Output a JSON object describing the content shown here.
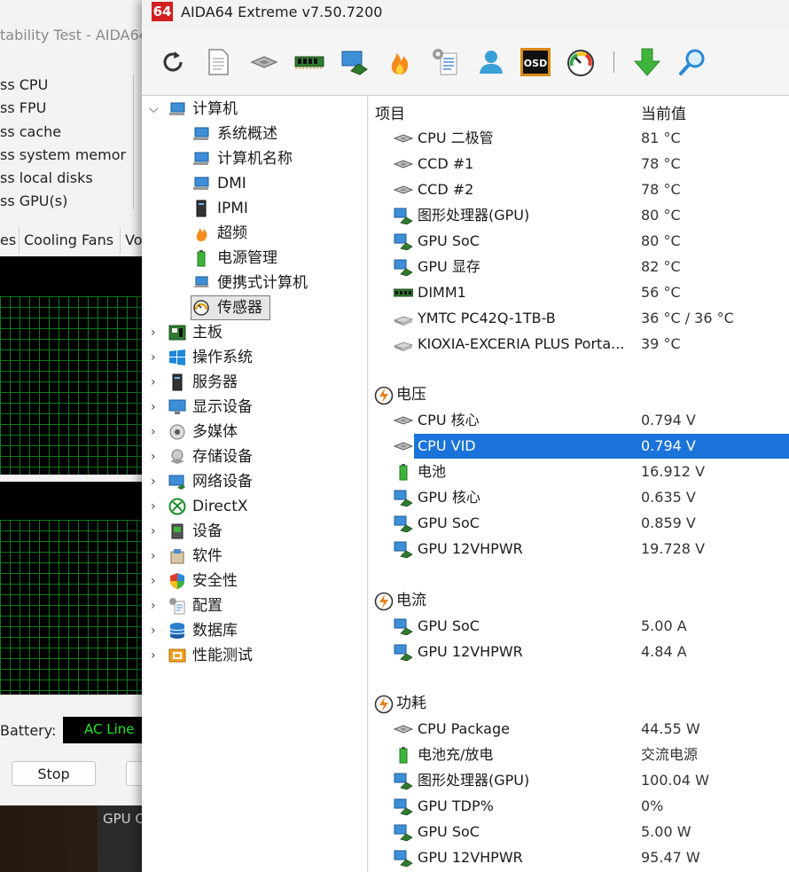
{
  "back_window": {
    "title": "tability Test - AIDA64",
    "stress_items": [
      "ss CPU",
      "ss FPU",
      "ss cache",
      "ss system memor",
      "ss local disks",
      "ss GPU(s)"
    ],
    "tabs": [
      "es",
      "Cooling Fans",
      "Vo"
    ],
    "battery_label": "Battery:",
    "battery_value": "AC Line",
    "stop_label": "Stop",
    "gpu_label": "GPU C"
  },
  "window": {
    "app_icon": "64",
    "title": "AIDA64 Extreme v7.50.7200"
  },
  "toolbar": {
    "buttons": [
      "refresh-icon",
      "report-icon",
      "cpu-icon",
      "memory-icon",
      "network-icon",
      "flame-icon",
      "tools-icon",
      "user-icon",
      "osd-icon",
      "gauge-icon",
      "download-icon",
      "search-icon"
    ],
    "osd_label": "OSD"
  },
  "tree": {
    "root": "计算机",
    "children": [
      "系统概述",
      "计算机名称",
      "DMI",
      "IPMI",
      "超频",
      "电源管理",
      "便携式计算机",
      "传感器"
    ],
    "top_items": [
      "主板",
      "操作系统",
      "服务器",
      "显示设备",
      "多媒体",
      "存储设备",
      "网络设备",
      "DirectX",
      "设备",
      "软件",
      "安全性",
      "配置",
      "数据库",
      "性能测试"
    ]
  },
  "columns": {
    "item": "项目",
    "value": "当前值"
  },
  "temperature": [
    {
      "icon": "cpu-icon",
      "name": "CPU 二极管",
      "value": "81 °C"
    },
    {
      "icon": "cpu-icon",
      "name": "CCD #1",
      "value": "78 °C"
    },
    {
      "icon": "cpu-icon",
      "name": "CCD #2",
      "value": "78 °C"
    },
    {
      "icon": "gpu-icon",
      "name": "图形处理器(GPU)",
      "value": "80 °C"
    },
    {
      "icon": "gpu-icon",
      "name": "GPU SoC",
      "value": "80 °C"
    },
    {
      "icon": "gpu-icon",
      "name": "GPU 显存",
      "value": "82 °C"
    },
    {
      "icon": "memory-icon",
      "name": "DIMM1",
      "value": "56 °C"
    },
    {
      "icon": "disk-icon",
      "name": "YMTC PC42Q-1TB-B",
      "value": "36 °C / 36 °C"
    },
    {
      "icon": "disk-icon",
      "name": "KIOXIA-EXCERIA PLUS Porta...",
      "value": "39 °C"
    }
  ],
  "sections": {
    "voltage": "电压",
    "current": "电流",
    "power": "功耗"
  },
  "voltage": [
    {
      "icon": "cpu-icon",
      "name": "CPU 核心",
      "value": "0.794 V"
    },
    {
      "icon": "cpu-icon",
      "name": "CPU VID",
      "value": "0.794 V"
    },
    {
      "icon": "battery-icon",
      "name": "电池",
      "value": "16.912 V"
    },
    {
      "icon": "gpu-icon",
      "name": "GPU 核心",
      "value": "0.635 V"
    },
    {
      "icon": "gpu-icon",
      "name": "GPU SoC",
      "value": "0.859 V"
    },
    {
      "icon": "gpu-icon",
      "name": "GPU 12VHPWR",
      "value": "19.728 V"
    }
  ],
  "current": [
    {
      "icon": "gpu-icon",
      "name": "GPU SoC",
      "value": "5.00 A"
    },
    {
      "icon": "gpu-icon",
      "name": "GPU 12VHPWR",
      "value": "4.84 A"
    }
  ],
  "power": [
    {
      "icon": "cpu-icon",
      "name": "CPU Package",
      "value": "44.55 W"
    },
    {
      "icon": "battery-icon",
      "name": "电池充/放电",
      "value": "交流电源"
    },
    {
      "icon": "gpu-icon",
      "name": "图形处理器(GPU)",
      "value": "100.04 W"
    },
    {
      "icon": "gpu-icon",
      "name": "GPU TDP%",
      "value": "0%"
    },
    {
      "icon": "gpu-icon",
      "name": "GPU SoC",
      "value": "5.00 W"
    },
    {
      "icon": "gpu-icon",
      "name": "GPU 12VHPWR",
      "value": "95.47 W"
    }
  ],
  "colors": {
    "selection": "#1a73d9",
    "graph_grid": "#0f7a1c",
    "battery_text": "#1ee82a",
    "app_icon_bg": "#d31f1f"
  }
}
